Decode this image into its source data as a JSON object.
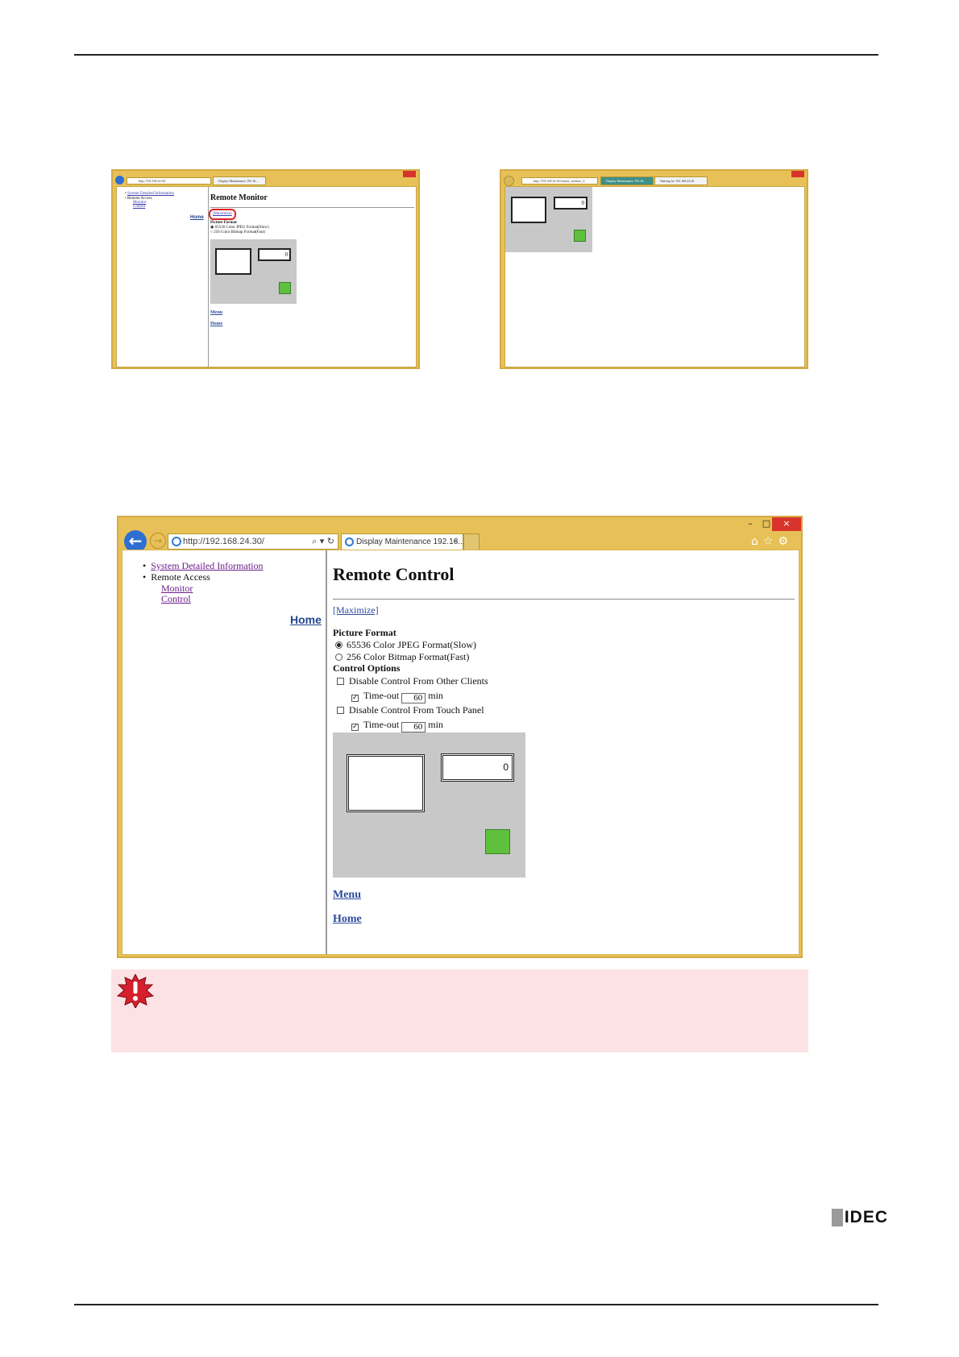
{
  "small_before": {
    "url": "http://192.168.24.30/",
    "tab": "Display Maintenance 192.16...",
    "nav": {
      "item1": "System Detailed Information",
      "item2": "Remote Access",
      "sub1": "Monitor",
      "sub2": "Control",
      "home": "Home"
    },
    "title": "Remote Monitor",
    "maximize": "[Maximize]",
    "format_label": "Picture Format",
    "option1": "65536 Color JPEG Format(Slow)",
    "option2": "256 Color Bitmap Format(Fast)",
    "screen_value": "0",
    "menu": "Menu",
    "home": "Home"
  },
  "small_after": {
    "url": "http://192.168.24.30/remote_monitor_h",
    "tab1": "Display Maintenance 192.16...",
    "tab2": "Waiting for 192.168.24.30",
    "screen_value": "0"
  },
  "big": {
    "url": "http://192.168.24.30/",
    "tab": "Display Maintenance 192.16...",
    "tab_close": "×",
    "window_controls": {
      "min": "–",
      "max": "□",
      "close": "×"
    },
    "nav": {
      "item1": "System Detailed Information",
      "item2": "Remote Access",
      "sub1": "Monitor",
      "sub2": "Control",
      "home": "Home"
    },
    "title": "Remote Control",
    "maximize": "[Maximize]",
    "format_label": "Picture Format",
    "option1": "65536 Color JPEG Format(Slow)",
    "option2": "256 Color Bitmap Format(Fast)",
    "control_label": "Control Options",
    "opt_clients": "Disable Control From Other Clients",
    "opt_panel": "Disable Control From Touch Panel",
    "timeout_label": "Time-out",
    "timeout_value1": "60",
    "timeout_value2": "60",
    "min_label": "min",
    "screen_value": "0",
    "menu": "Menu",
    "home": "Home"
  },
  "icons": [
    "back-arrow-icon",
    "forward-arrow-icon",
    "search-icon",
    "refresh-icon",
    "home-icon",
    "favorites-star-icon",
    "settings-gear-icon",
    "right-arrow-icon",
    "warning-icon"
  ],
  "footer": {
    "logo": "IDEC"
  },
  "colors": {
    "window_frame": "#e7c157",
    "warning_bg": "#fde2e5",
    "link_purple": "#6a1d86",
    "link_blue": "#2d4a9e",
    "green": "#5fc03e"
  }
}
